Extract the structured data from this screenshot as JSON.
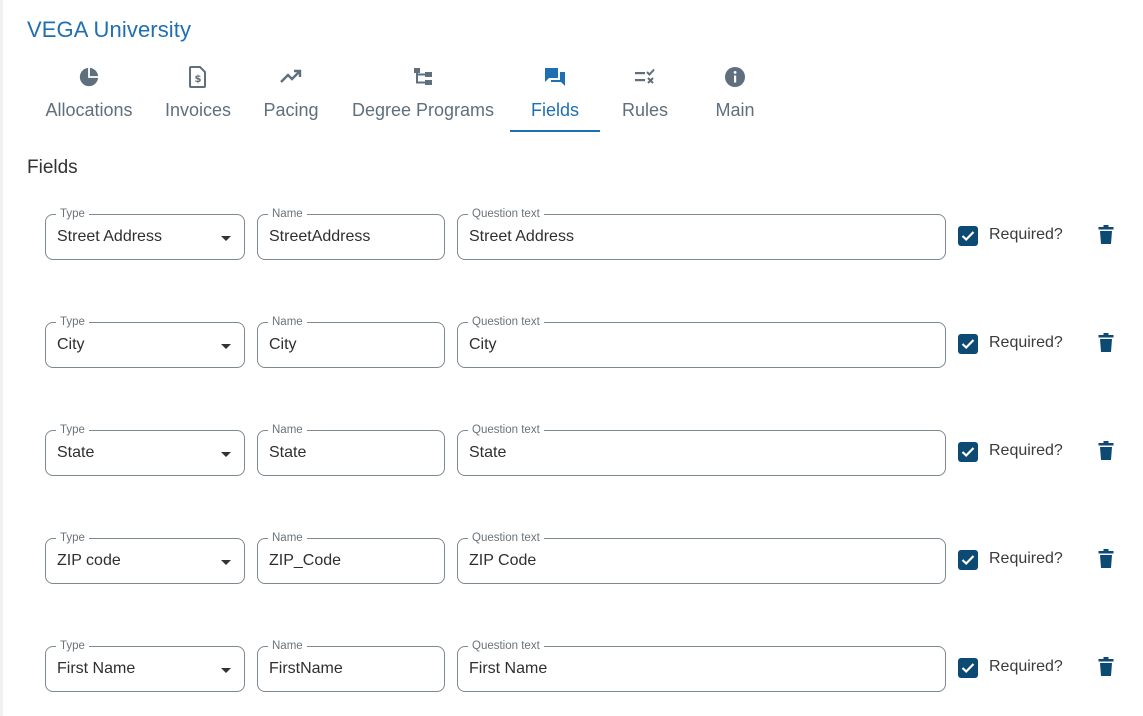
{
  "app": {
    "title": "VEGA University"
  },
  "tabs": [
    {
      "label": "Allocations",
      "icon": "pie-chart-icon",
      "active": false
    },
    {
      "label": "Invoices",
      "icon": "invoice-dollar-icon",
      "active": false
    },
    {
      "label": "Pacing",
      "icon": "trending-up-icon",
      "active": false
    },
    {
      "label": "Degree Programs",
      "icon": "hierarchy-icon",
      "active": false
    },
    {
      "label": "Fields",
      "icon": "chat-bubbles-icon",
      "active": true
    },
    {
      "label": "Rules",
      "icon": "rule-check-icon",
      "active": false
    },
    {
      "label": "Main",
      "icon": "info-icon",
      "active": false
    }
  ],
  "section": {
    "title": "Fields"
  },
  "field_labels": {
    "type": "Type",
    "name": "Name",
    "question": "Question text",
    "required": "Required?"
  },
  "rows": [
    {
      "type": "Street Address",
      "name": "StreetAddress",
      "question": "Street Address",
      "required": true
    },
    {
      "type": "City",
      "name": "City",
      "question": "City",
      "required": true
    },
    {
      "type": "State",
      "name": "State",
      "question": "State",
      "required": true
    },
    {
      "type": "ZIP code",
      "name": "ZIP_Code",
      "question": "ZIP Code",
      "required": true
    },
    {
      "type": "First Name",
      "name": "FirstName",
      "question": "First Name",
      "required": true
    }
  ],
  "colors": {
    "accent": "#1f6fb2",
    "tab_inactive": "#5f6f7d",
    "checkbox": "#0d4a73",
    "trash": "#0d4a73"
  }
}
